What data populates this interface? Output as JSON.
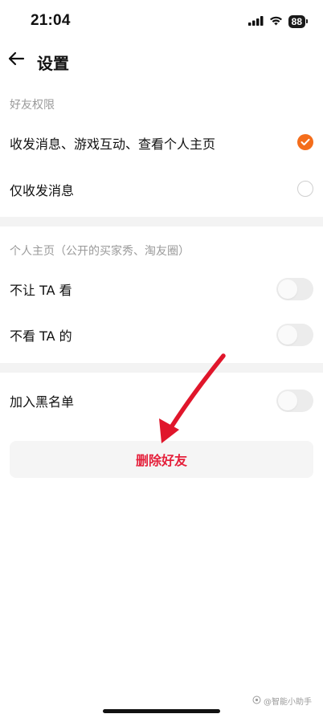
{
  "status_bar": {
    "time": "21:04",
    "battery": "88"
  },
  "nav": {
    "title": "设置"
  },
  "friend_permissions": {
    "header": "好友权限",
    "options": [
      {
        "label": "收发消息、游戏互动、查看个人主页",
        "selected": true
      },
      {
        "label": "仅收发消息",
        "selected": false
      }
    ]
  },
  "profile": {
    "header": "个人主页（公开的买家秀、淘友圈）",
    "toggles": [
      {
        "label": "不让 TA 看",
        "on": false
      },
      {
        "label": "不看 TA 的",
        "on": false
      }
    ]
  },
  "blacklist": {
    "label": "加入黑名单",
    "on": false
  },
  "delete_button": {
    "label": "删除好友"
  },
  "watermark": {
    "text": "@智能小助手"
  },
  "colors": {
    "accent": "#f46d1b",
    "danger": "#e5203b",
    "annotation_arrow": "#e0162b"
  }
}
